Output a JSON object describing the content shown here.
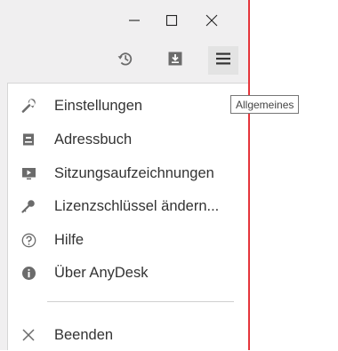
{
  "window": {
    "accent_color": "#e5353b",
    "controls": [
      {
        "name": "minimize-icon",
        "glyph": "–"
      },
      {
        "name": "maximize-icon",
        "glyph": "□"
      },
      {
        "name": "close-icon",
        "glyph": "×"
      }
    ]
  },
  "toolbar": {
    "buttons": [
      {
        "name": "history-icon"
      },
      {
        "name": "download-icon"
      },
      {
        "name": "hamburger-menu-icon",
        "active": true
      }
    ]
  },
  "tooltip": {
    "text": "Allgemeines"
  },
  "menu": {
    "items": [
      {
        "label": "Einstellungen",
        "icon": "wrench-icon"
      },
      {
        "label": "Adressbuch",
        "icon": "address-book-icon"
      },
      {
        "label": "Sitzungsaufzeichnungen",
        "icon": "recording-icon"
      },
      {
        "label": "Lizenzschlüssel ändern...",
        "icon": "key-icon"
      },
      {
        "label": "Hilfe",
        "icon": "help-icon"
      },
      {
        "label": "Über AnyDesk",
        "icon": "info-icon"
      },
      {
        "label": "Beenden",
        "icon": "exit-icon"
      }
    ]
  }
}
